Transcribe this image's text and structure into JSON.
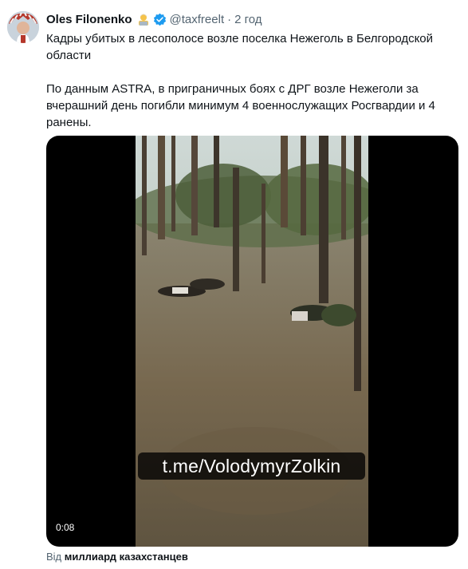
{
  "tweet": {
    "author_name": "Oles Filonenko",
    "author_emoji": "man-technologist-emoji",
    "verified_icon": "verified-badge-icon",
    "handle": "@taxfreelt",
    "separator": "·",
    "time": "2 год",
    "text": "Кадры убитых в лесополосе возле поселка Нежеголь в Белгородской области\n\nПо данным ASTRA, в приграничных боях с ДРГ возле Нежеголи за вчерашний день погибли минимум 4 военнослужащих Росгвардии и 4 ранены."
  },
  "media": {
    "watermark": "t.me/VolodymyrZolkin",
    "duration": "0:08"
  },
  "source": {
    "prefix": "Від",
    "name": "миллиард казахстанцев"
  },
  "colors": {
    "text": "#0f1419",
    "secondary": "#536471",
    "verified": "#1d9bf0"
  }
}
